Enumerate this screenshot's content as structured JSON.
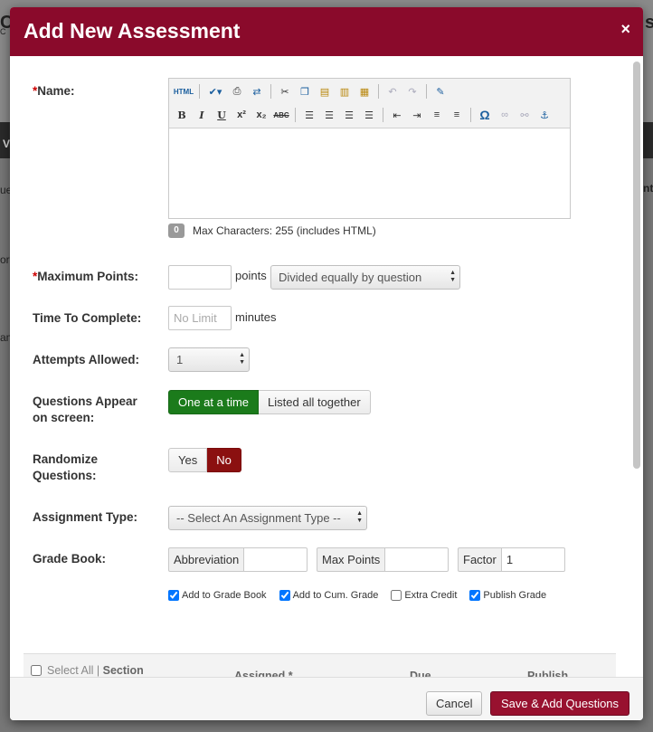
{
  "background": {
    "fragments": [
      "C",
      "s",
      "C",
      "V",
      "ue",
      "nt",
      "or",
      "am"
    ]
  },
  "modal": {
    "title": "Add New Assessment",
    "close_label": "×",
    "colors": {
      "header": "#8a0a2b",
      "primary_button": "#98112f",
      "active_green": "#1b7b1b",
      "active_red": "#8b1010"
    }
  },
  "form": {
    "name": {
      "required_mark": "*",
      "label": "Name:",
      "toolbar": {
        "row1": [
          "html-source-icon",
          "spellcheck-icon",
          "print-icon",
          "find-replace-icon",
          "cut-icon",
          "copy-icon",
          "paste-icon",
          "paste-text-icon",
          "paste-word-icon",
          "undo-icon",
          "redo-icon",
          "edit-icon"
        ],
        "row2": [
          "bold-icon",
          "italic-icon",
          "underline-icon",
          "superscript-icon",
          "subscript-icon",
          "strikethrough-icon",
          "align-left-icon",
          "align-center-icon",
          "align-right-icon",
          "align-justify-icon",
          "outdent-icon",
          "indent-icon",
          "numbered-list-icon",
          "bullet-list-icon",
          "special-char-icon",
          "link-icon",
          "unlink-icon",
          "anchor-icon"
        ]
      },
      "char_count": "0",
      "max_chars_text": "Max Characters: 255 (includes HTML)"
    },
    "max_points": {
      "required_mark": "*",
      "label": "Maximum Points:",
      "value": "",
      "unit": "points",
      "distribution_selected": "Divided equally by question"
    },
    "time_to_complete": {
      "label": "Time To Complete:",
      "placeholder": "No Limit",
      "unit": "minutes"
    },
    "attempts": {
      "label": "Attempts Allowed:",
      "selected": "1"
    },
    "questions_appear": {
      "label_line1": "Questions Appear",
      "label_line2": "on screen:",
      "options": [
        "One at a time",
        "Listed all together"
      ],
      "active": "One at a time"
    },
    "randomize": {
      "label_line1": "Randomize",
      "label_line2": "Questions:",
      "options": [
        "Yes",
        "No"
      ],
      "active": "No"
    },
    "assignment_type": {
      "label": "Assignment Type:",
      "selected": "-- Select An Assignment Type --"
    },
    "grade_book": {
      "label": "Grade Book:",
      "abbreviation_label": "Abbreviation",
      "abbreviation_value": "",
      "max_points_label": "Max Points",
      "max_points_value": "",
      "factor_label": "Factor",
      "factor_value": "1",
      "checkboxes": [
        {
          "label": "Add to Grade Book",
          "checked": true
        },
        {
          "label": "Add to Cum. Grade",
          "checked": true
        },
        {
          "label": "Extra Credit",
          "checked": false
        },
        {
          "label": "Publish Grade",
          "checked": true
        }
      ]
    }
  },
  "sections_table": {
    "select_all": "Select All",
    "divider": "|",
    "section": "Section",
    "assigned": "Assigned *",
    "due": "Due",
    "publish": "Publish"
  },
  "footer": {
    "cancel_label": "Cancel",
    "save_label": "Save & Add Questions"
  }
}
